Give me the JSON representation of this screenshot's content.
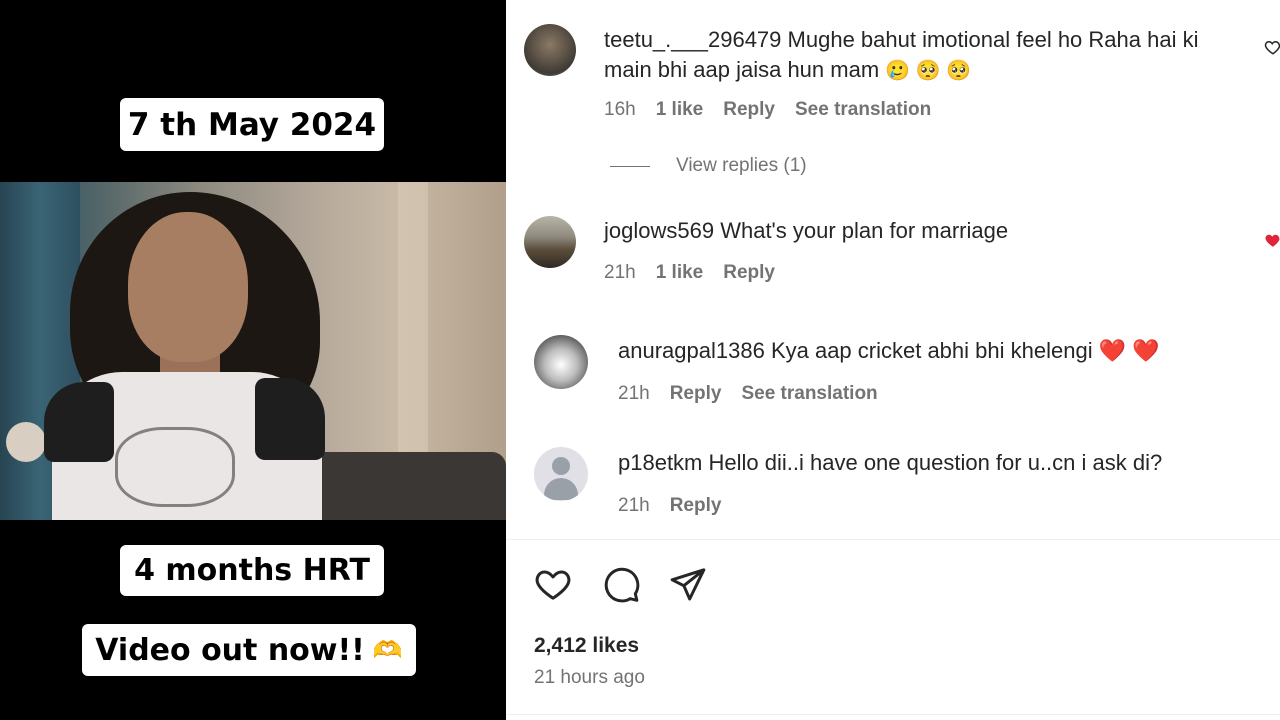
{
  "media": {
    "date_caption": "7 th May 2024",
    "hrt_caption": "4 months HRT",
    "video_caption": "Video out now!!",
    "video_caption_emoji": "🫶"
  },
  "comments": [
    {
      "username": "teetu_.___296479",
      "text_line1": "Mughe bahut imotional feel ho Raha hai ki",
      "text_line2": "main bhi aap jaisa hun mam",
      "emojis": "🥲 🥺 🥺",
      "time": "16h",
      "likes": "1 like",
      "reply": "Reply",
      "translation": "See translation",
      "view_replies": "View replies (1)"
    },
    {
      "username": "joglows569",
      "text": "What's your plan for marriage",
      "time": "21h",
      "likes": "1 like",
      "reply": "Reply"
    },
    {
      "username": "anuragpal1386",
      "text": "Kya aap cricket abhi bhi khelengi",
      "emojis": "❤️ ❤️",
      "time": "21h",
      "reply": "Reply",
      "translation": "See translation"
    },
    {
      "username": "p18etkm",
      "text": "Hello dii..i have one question for u..cn i ask di?",
      "time": "21h",
      "reply": "Reply"
    }
  ],
  "post": {
    "likes": "2,412 likes",
    "time": "21 hours ago"
  },
  "icons": {
    "like": "heart-outline-icon",
    "comment": "comment-bubble-icon",
    "share": "paper-plane-icon",
    "liked_color": "#e0243a"
  }
}
